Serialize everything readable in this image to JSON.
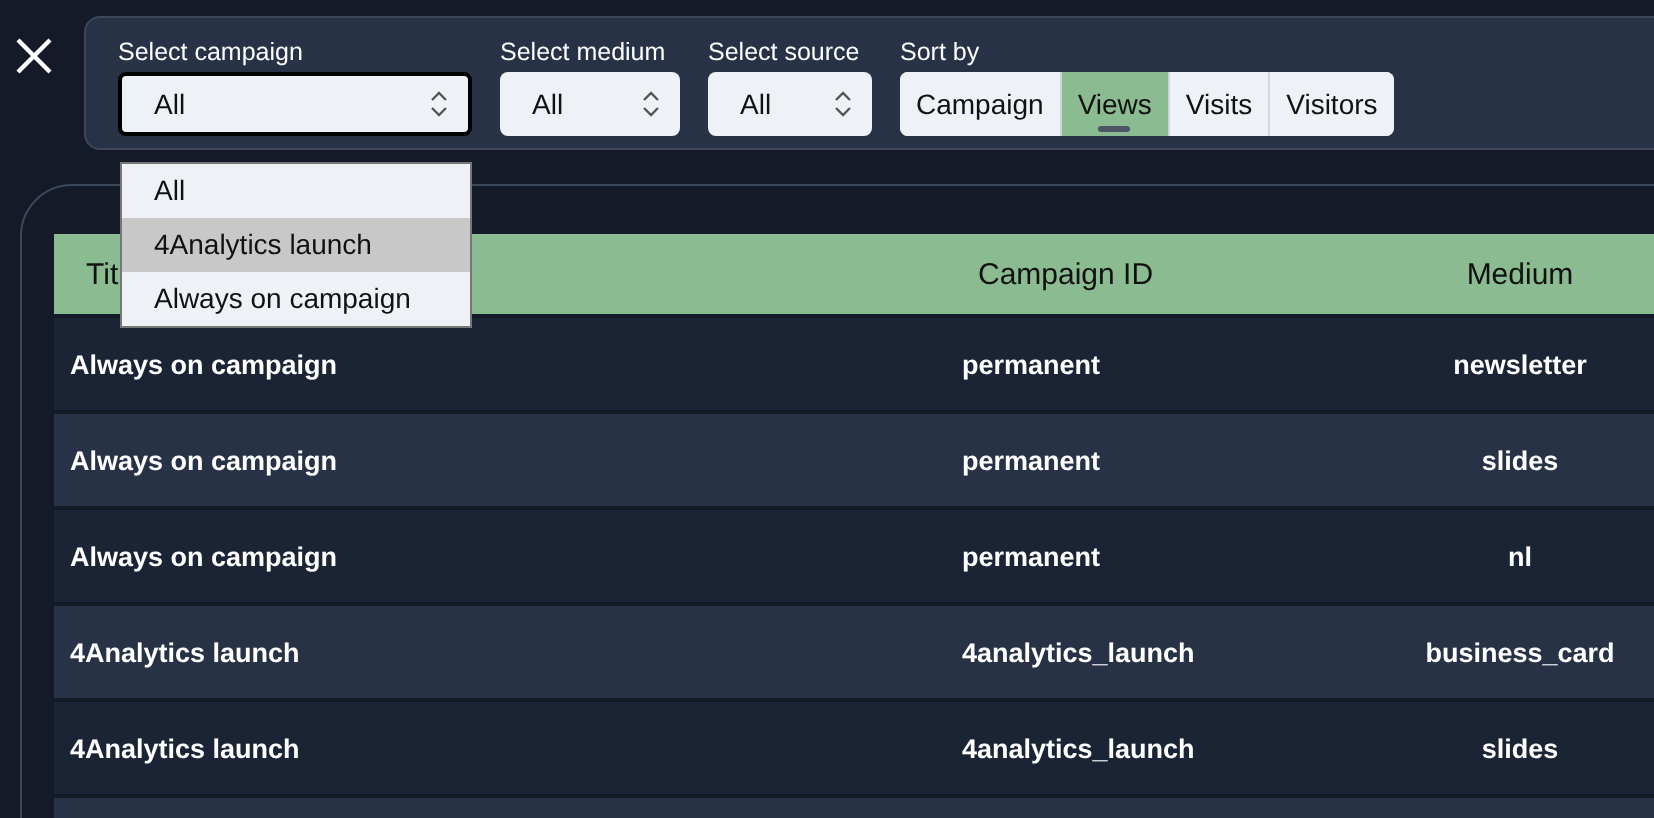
{
  "filters": [
    {
      "label": "Select campaign",
      "value": "All",
      "focused": true
    },
    {
      "label": "Select medium",
      "value": "All",
      "focused": false
    },
    {
      "label": "Select source",
      "value": "All",
      "focused": false
    }
  ],
  "campaign_dropdown": {
    "options": [
      {
        "label": "All",
        "selected": false
      },
      {
        "label": "4Analytics launch",
        "selected": true
      },
      {
        "label": "Always on campaign",
        "selected": false
      }
    ]
  },
  "sort": {
    "label": "Sort by",
    "options": [
      {
        "label": "Campaign",
        "selected": false
      },
      {
        "label": "Views",
        "selected": true
      },
      {
        "label": "Visits",
        "selected": false
      },
      {
        "label": "Visitors",
        "selected": false
      }
    ]
  },
  "table": {
    "columns": [
      "Tit",
      "Campaign ID",
      "Medium"
    ],
    "rows": [
      [
        "Always on campaign",
        "permanent",
        "newsletter"
      ],
      [
        "Always on campaign",
        "permanent",
        "slides"
      ],
      [
        "Always on campaign",
        "permanent",
        "nl"
      ],
      [
        "4Analytics launch",
        "4analytics_launch",
        "business_card"
      ],
      [
        "4Analytics launch",
        "4analytics_launch",
        "slides"
      ]
    ]
  }
}
